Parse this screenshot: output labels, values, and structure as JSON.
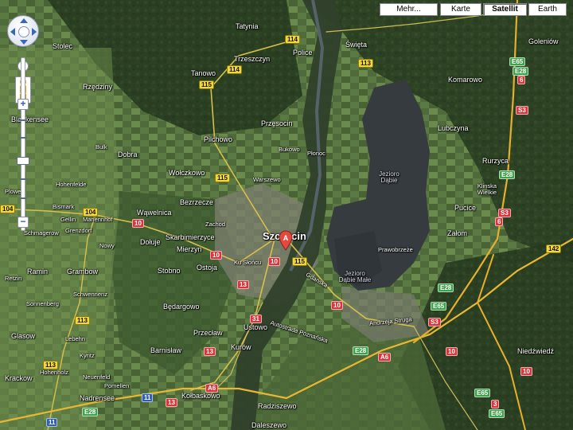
{
  "map_types": {
    "more": "Mehr...",
    "map": "Karte",
    "satellite": "Satellit",
    "earth": "Earth",
    "active": "satellite"
  },
  "zoom_controls": {
    "zoom_in": "+",
    "zoom_out": "−",
    "zoom_level": 0.6
  },
  "marker": {
    "letter": "A",
    "color": "#e04a3f"
  },
  "labels": {
    "city_main": "Szczecin",
    "places": [
      "Stolec",
      "Rzędziny",
      "Tatynia",
      "Police",
      "Trzeszczyn",
      "Tanowo",
      "Święta",
      "Goleniów",
      "Blankensee",
      "Dobra",
      "Pilchowo",
      "Przęsocin",
      "Bukowo",
      "Płonoc",
      "Komarowo",
      "Lubczyna",
      "Bismark",
      "Gellin",
      "Mariennhof",
      "Grenzdorf",
      "Schmagerow",
      "Wąwelnica",
      "Bezrzecze",
      "Wołczkowo",
      "Warszewo",
      "Zachod",
      "Skarbimierzyce",
      "Dołuje",
      "Mierzyn",
      "Stobno",
      "Ostoja",
      "Będargowo",
      "Przecław",
      "Ustowo",
      "Barnisław",
      "Kurów",
      "Ramin",
      "Grambow",
      "Retzin",
      "Schwennenz",
      "Sonnenberg",
      "Glasow",
      "Lebehn",
      "Krackow",
      "Hohenholz",
      "Kyritz",
      "Neuenfeld",
      "Pomellen",
      "Nadrensee",
      "Kołbaskowo",
      "Radziszewo",
      "Daleszewo",
      "Rurzyca",
      "Klinska Wielkie",
      "Pucice",
      "Załom",
      "Prawobrzeże",
      "Niedźwiedź",
      "Ku Słońcu",
      "Gdańska",
      "Autostrada Poznańska",
      "Andrzeja Struga",
      "Hohenfelde",
      "Plowen",
      "Bulk",
      "Nowy"
    ],
    "water": [
      "Jezioro Dąbie",
      "Jezioro Dąbie Małe"
    ]
  },
  "road_shields": [
    {
      "text": "114",
      "type": "yellow"
    },
    {
      "text": "114",
      "type": "yellow"
    },
    {
      "text": "115",
      "type": "yellow"
    },
    {
      "text": "113",
      "type": "yellow"
    },
    {
      "text": "115",
      "type": "yellow"
    },
    {
      "text": "115",
      "type": "yellow"
    },
    {
      "text": "104",
      "type": "yellow"
    },
    {
      "text": "104",
      "type": "yellow"
    },
    {
      "text": "113",
      "type": "yellow"
    },
    {
      "text": "113",
      "type": "yellow"
    },
    {
      "text": "142",
      "type": "yellow"
    },
    {
      "text": "10",
      "type": "red"
    },
    {
      "text": "10",
      "type": "red"
    },
    {
      "text": "10",
      "type": "red"
    },
    {
      "text": "13",
      "type": "red"
    },
    {
      "text": "31",
      "type": "red"
    },
    {
      "text": "13",
      "type": "red"
    },
    {
      "text": "13",
      "type": "red"
    },
    {
      "text": "10",
      "type": "red"
    },
    {
      "text": "10",
      "type": "red"
    },
    {
      "text": "10",
      "type": "red"
    },
    {
      "text": "6",
      "type": "red"
    },
    {
      "text": "S3",
      "type": "red"
    },
    {
      "text": "S3",
      "type": "red"
    },
    {
      "text": "6",
      "type": "red"
    },
    {
      "text": "S3",
      "type": "red"
    },
    {
      "text": "A6",
      "type": "red"
    },
    {
      "text": "A6",
      "type": "red"
    },
    {
      "text": "3",
      "type": "red"
    },
    {
      "text": "E65",
      "type": "green"
    },
    {
      "text": "E28",
      "type": "green"
    },
    {
      "text": "E28",
      "type": "green"
    },
    {
      "text": "E28",
      "type": "green"
    },
    {
      "text": "E65",
      "type": "green"
    },
    {
      "text": "E28",
      "type": "green"
    },
    {
      "text": "E65",
      "type": "green"
    },
    {
      "text": "E28",
      "type": "green"
    },
    {
      "text": "E65",
      "type": "green"
    },
    {
      "text": "11",
      "type": "blue"
    },
    {
      "text": "11",
      "type": "blue"
    }
  ]
}
